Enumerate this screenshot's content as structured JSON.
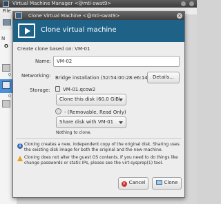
{
  "main_window": {
    "title": "Virtual Machine Manager <@mti-swat9>",
    "menu_file": "File",
    "list_header": "N",
    "list_group": "O",
    "row_label": "Q"
  },
  "dialog": {
    "title": "Clone Virtual Machine <@mti-swat9>",
    "close_glyph": "×",
    "header_title": "Clone virtual machine",
    "based_on_label": "Create clone based on: VM-01",
    "name_label": "Name:",
    "name_value": "VM-02",
    "networking_label": "Networking:",
    "networking_value": "Bridge installation (52:54:00:28:e6:14)",
    "details_button": "Details...",
    "storage_label": "Storage:",
    "disk1_name": "VM-01.qcow2",
    "disk1_action": "Clone this disk (60.0 GiB)",
    "disk2_name": "- (Removable, Read Only)",
    "disk2_action": "Share disk with VM-01",
    "disk2_note": "Nothing to clone.",
    "info_note": "Cloning creates a new, independent copy of the original disk. Sharing uses the existing disk image for both the original and the new machine.",
    "warning_note": "Cloning does not alter the guest OS contents. If you need to do things like change passwords or static IPs, please see the virt-sysprep(1) tool.",
    "cancel_button": "Cancel",
    "clone_button": "Clone",
    "icons": {
      "info": "info-icon",
      "warning": "warning-icon",
      "cancel": "cancel-icon",
      "clone": "clone-icon",
      "header": "monitor-play-icon"
    },
    "colors": {
      "header_bg": "#1f6288"
    }
  }
}
